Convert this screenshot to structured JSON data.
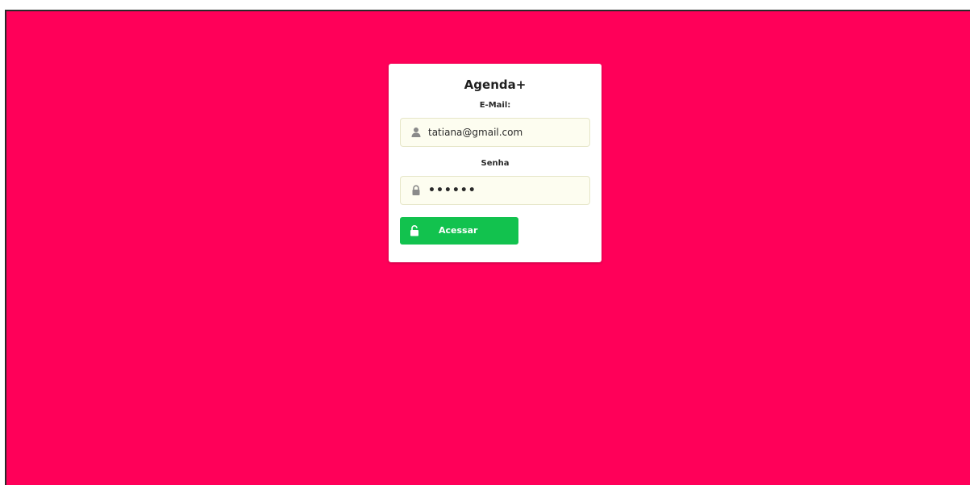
{
  "login": {
    "title": "Agenda+",
    "email": {
      "label": "E-Mail:",
      "value": "tatiana@gmail.com",
      "icon": "user-icon"
    },
    "password": {
      "label": "Senha",
      "value": "••••••",
      "icon": "lock-icon"
    },
    "submit": {
      "label": "Acessar",
      "icon": "unlock-icon"
    }
  },
  "colors": {
    "background": "#ff0059",
    "card": "#ffffff",
    "input_bg": "#fdfdf0",
    "button": "#12c24e"
  }
}
